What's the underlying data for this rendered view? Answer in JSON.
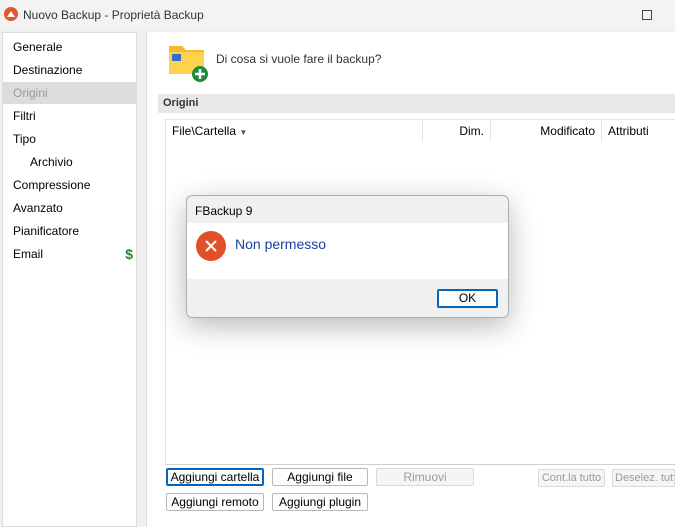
{
  "window": {
    "title": "Nuovo Backup - Proprietà Backup"
  },
  "sidebar": {
    "items": [
      {
        "label": "Generale"
      },
      {
        "label": "Destinazione"
      },
      {
        "label": "Origini"
      },
      {
        "label": "Filtri"
      },
      {
        "label": "Tipo"
      },
      {
        "label": "Archivio"
      },
      {
        "label": "Compressione"
      },
      {
        "label": "Avanzato"
      },
      {
        "label": "Pianificatore"
      },
      {
        "label": "Email",
        "badge": "$"
      }
    ]
  },
  "main": {
    "question": "Di cosa si vuole fare il backup?",
    "section_header": "Origini",
    "columns": {
      "file": "File\\Cartella",
      "size": "Dim.",
      "modified": "Modificato",
      "attributes": "Attributi"
    },
    "buttons": {
      "add_folder": "Aggiungi cartella",
      "add_file": "Aggiungi file",
      "remove": "Rimuovi",
      "check_all": "Cont.la tutto",
      "deselect_all": "Deselez. tutto",
      "add_remote": "Aggiungi remoto",
      "add_plugin": "Aggiungi plugin"
    }
  },
  "dialog": {
    "title": "FBackup 9",
    "message": "Non permesso",
    "ok_label": "OK"
  },
  "colors": {
    "accent": "#0067c0",
    "error": "#e0512a",
    "message": "#1d3fa2",
    "badge": "#1e8a2e"
  }
}
